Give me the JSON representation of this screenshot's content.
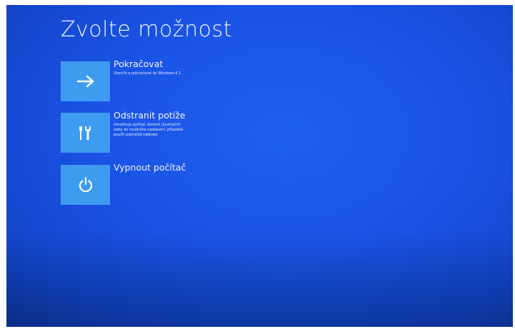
{
  "title": "Zvolte možnost",
  "options": [
    {
      "label": "Pokračovat",
      "description": "Ukončit a pokračovat do Windows 8.1",
      "icon": "arrow-right-icon"
    },
    {
      "label": "Odstranit potíže",
      "description": "Umožňuje počítač obnovit (ilustrační)\nnebo do továrního nastavení, případně\npoužít pokročilé nástroje",
      "icon": "tools-icon"
    },
    {
      "label": "Vypnout počítač",
      "description": "",
      "icon": "power-icon"
    }
  ],
  "colors": {
    "background": "#1a54e6",
    "tile": "#3d9bf0",
    "text": "#ffffff"
  }
}
